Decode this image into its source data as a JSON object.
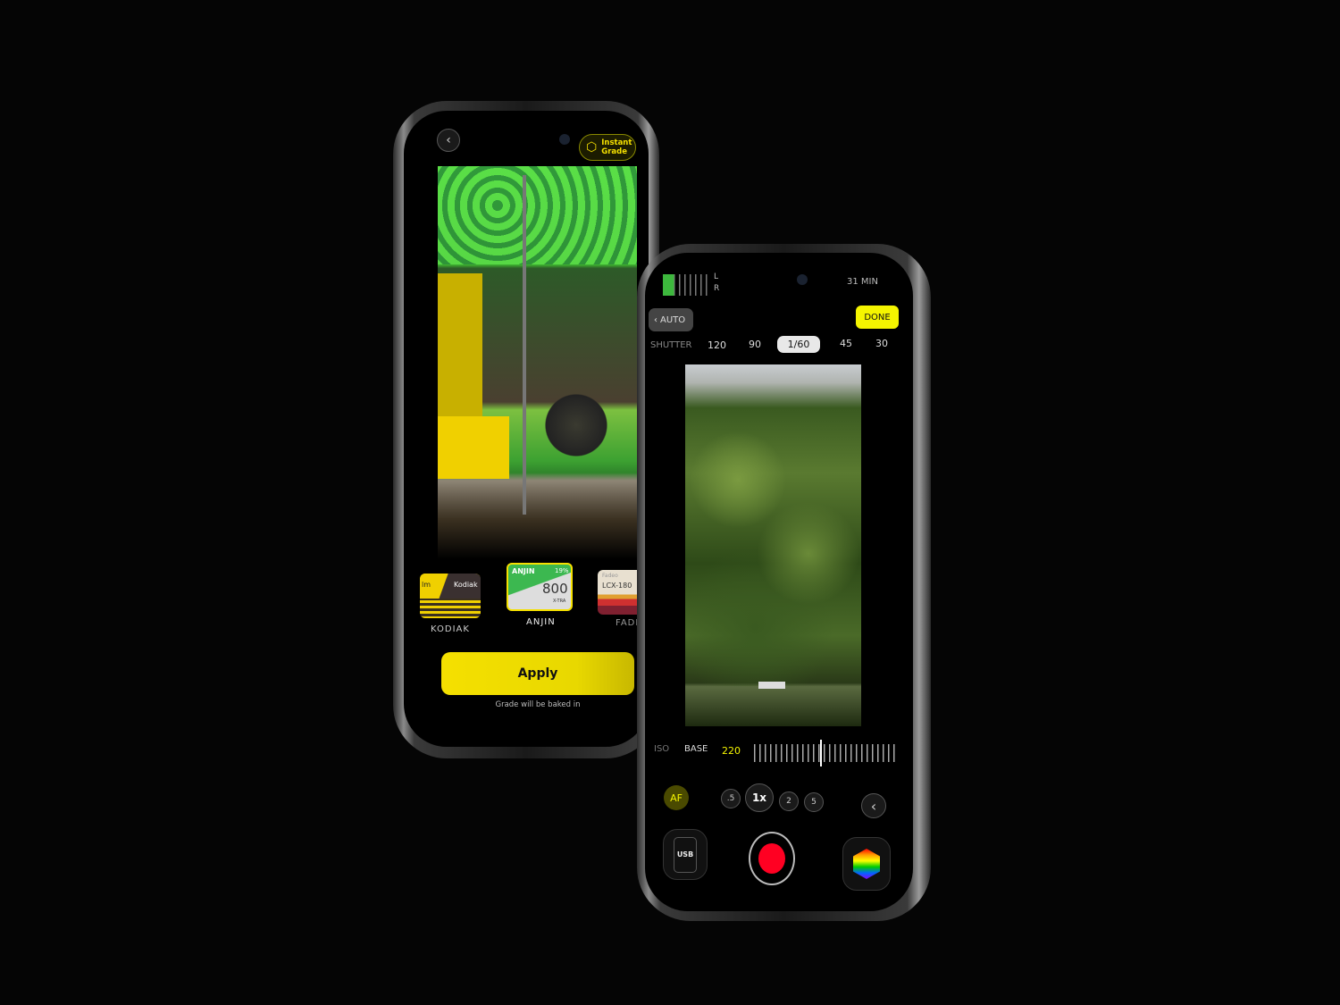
{
  "grade_screen": {
    "instant_grade_label_1": "Instant",
    "instant_grade_label_2": "Grade",
    "films": [
      {
        "name": "KODIAK",
        "brand": "Kodiak",
        "prefix": "lm"
      },
      {
        "name": "ANJIN",
        "brand": "ANJIN",
        "percent": "19%",
        "speed": "800",
        "sub": "X-TRA"
      },
      {
        "name": "FADE",
        "brand": "Fadeo",
        "model": "LCX-180"
      }
    ],
    "apply_label": "Apply",
    "note": "Grade will be baked in",
    "accent": "#f5e000"
  },
  "camera_screen": {
    "audio_channels": [
      "L",
      "R"
    ],
    "time_remaining": "31 MIN",
    "auto_label": "AUTO",
    "done_label": "DONE",
    "shutter": {
      "label": "SHUTTER",
      "options": [
        "120",
        "90",
        "1/60",
        "45",
        "30"
      ],
      "selected": "1/60"
    },
    "iso": {
      "label": "ISO",
      "mode": "BASE",
      "value": "220"
    },
    "af_label": "AF",
    "zoom_levels": [
      ".5",
      "1x",
      "2",
      "5"
    ],
    "zoom_selected": "1x",
    "usb_label": "USB",
    "record_color": "#ff0022",
    "accent": "#f5f500"
  }
}
